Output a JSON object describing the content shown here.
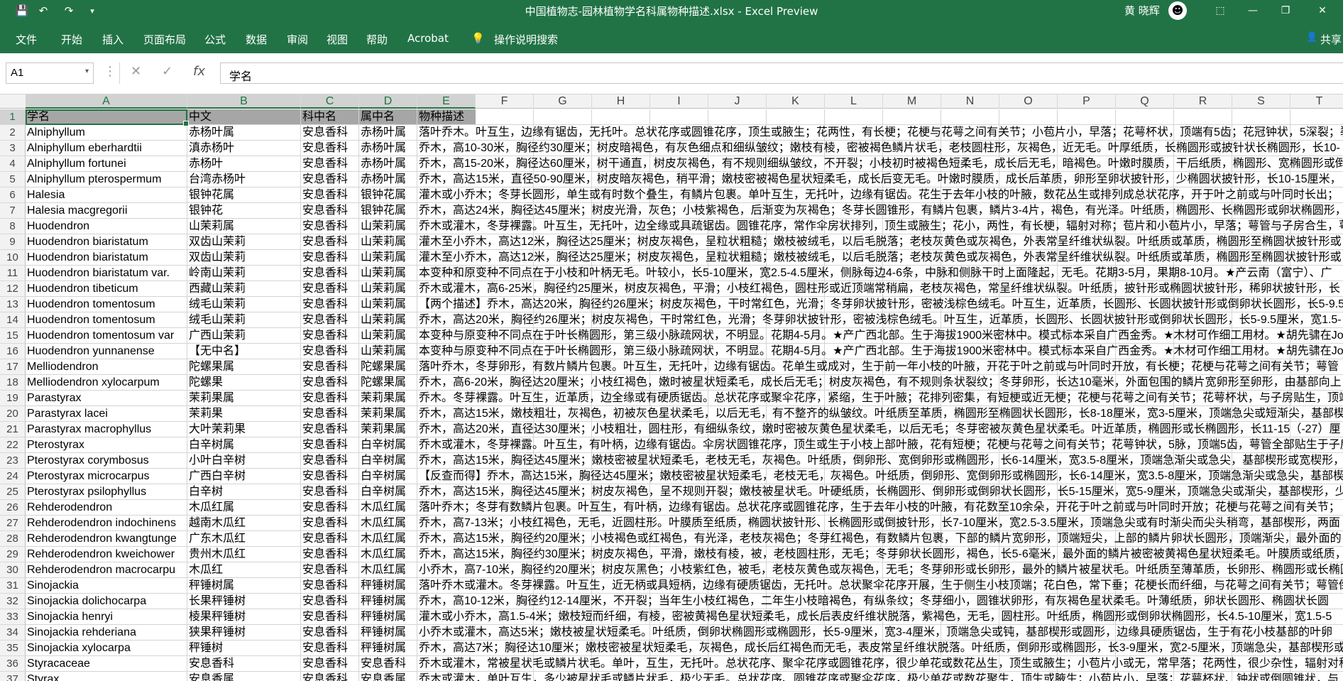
{
  "window": {
    "title": "中国植物志-园林植物学名科属物种描述.xlsx  -  Excel Preview",
    "user": "黄 晓辉",
    "qat": {
      "save": "💾",
      "undo": "↶",
      "redo": "↷",
      "customize": "▾"
    },
    "controls": {
      "ribbon_display": "⬚",
      "minimize": "—",
      "restore": "❐",
      "close": "✕"
    }
  },
  "ribbon": {
    "tabs": [
      "文件",
      "开始",
      "插入",
      "页面布局",
      "公式",
      "数据",
      "审阅",
      "视图",
      "帮助",
      "Acrobat"
    ],
    "tell_me": "操作说明搜索",
    "share": "共享",
    "tell_me_icon": "💡",
    "share_icon": "👤"
  },
  "formula_bar": {
    "name_box": "A1",
    "dropdown": "▾",
    "more": "⋮",
    "cancel": "✕",
    "enter": "✓",
    "fx": "fx",
    "content": "学名"
  },
  "columns": [
    "A",
    "B",
    "C",
    "D",
    "E",
    "F",
    "G",
    "H",
    "I",
    "J",
    "K",
    "L",
    "M",
    "N",
    "O",
    "P",
    "Q",
    "R",
    "S",
    "T"
  ],
  "rows": [
    {
      "n": "1",
      "cells": [
        "学名",
        "中文",
        "科中名",
        "属中名",
        "物种描述"
      ]
    },
    {
      "n": "2",
      "cells": [
        "Alniphyllum",
        "赤杨叶属",
        "安息香科",
        "赤杨叶属",
        "落叶乔木。叶互生，边缘有锯齿，无托叶。总状花序或圆锥花序，顶生或腋生；花两性，有长梗；花梗与花萼之间有关节；小苞片小，早落；花萼杯状，顶端有5齿；花冠钟状，5深裂；裂"
      ]
    },
    {
      "n": "3",
      "cells": [
        "Alniphyllum eberhardtii",
        "滇赤杨叶",
        "安息香科",
        "赤杨叶属",
        "乔木，高10-30米，胸径约30厘米；树皮暗褐色，有灰色细点和细纵皱纹；嫩枝有棱，密被褐色鳞片状毛，老枝圆柱形，灰褐色，近无毛。叶厚纸质，长椭圆形或披针状长椭圆形，长10-"
      ]
    },
    {
      "n": "4",
      "cells": [
        "Alniphyllum fortunei",
        "赤杨叶",
        "安息香科",
        "赤杨叶属",
        "乔木，高15-20米，胸径达60厘米，树干通直，树皮灰褐色，有不规则细纵皱纹，不开裂；小枝初时被褐色短柔毛，成长后无毛，暗褐色。叶嫩时膜质，干后纸质，椭圆形、宽椭圆形或倒"
      ]
    },
    {
      "n": "5",
      "cells": [
        "Alniphyllum pterospermum",
        "台湾赤杨叶",
        "安息香科",
        "赤杨叶属",
        "乔木，高达15米，直径50-90厘米，树皮暗灰褐色，稍平滑；嫩枝密被褐色星状短柔毛，成长后变无毛。叶嫩时膜质，成长后革质，卵形至卵状披针形，少椭圆状披针形，长10-15厘米，"
      ]
    },
    {
      "n": "6",
      "cells": [
        "Halesia",
        "银钟花属",
        "安息香科",
        "银钟花属",
        "灌木或小乔木；冬芽长圆形，单生或有时数个叠生，有鳞片包裹。单叶互生，无托叶，边缘有锯齿。花生于去年小枝的叶腋，数花丛生或排列成总状花序，开于叶之前或与叶同时长出；"
      ]
    },
    {
      "n": "7",
      "cells": [
        "Halesia macgregorii",
        "银钟花",
        "安息香科",
        "银钟花属",
        "乔木，高达24米，胸径达45厘米；树皮光滑，灰色；小枝紫褐色，后渐变为灰褐色；冬芽长圆锥形，有鳞片包裹，鳞片3-4片，褐色，有光泽。叶纸质，椭圆形、长椭圆形或卵状椭圆形，"
      ]
    },
    {
      "n": "8",
      "cells": [
        "Huodendron",
        "山茉莉属",
        "安息香科",
        "山茉莉属",
        "乔木或灌木，冬芽裸露。叶互生，无托叶，边全缘或具疏锯齿。圆锥花序，常作伞房状排列，顶生或腋生；花小，两性，有长梗，辐射对称；苞片和小苞片小，早落；萼管与子房合生，萼"
      ]
    },
    {
      "n": "9",
      "cells": [
        "Huodendron biaristatum",
        "双齿山茉莉",
        "安息香科",
        "山茉莉属",
        "灌木至小乔木，高达12米，胸径达25厘米；树皮灰褐色，呈粒状粗糙；嫩枝被绒毛，以后毛脱落；老枝灰黄色或灰褐色，外表常呈纤维状纵裂。叶纸质或革质，椭圆形至椭圆状披针形或"
      ]
    },
    {
      "n": "10",
      "cells": [
        "Huodendron biaristatum",
        "双齿山茉莉",
        "安息香科",
        "山茉莉属",
        "灌木至小乔木，高达12米，胸径达25厘米；树皮灰褐色，呈粒状粗糙；嫩枝被绒毛，以后毛脱落；老枝灰黄色或灰褐色，外表常呈纤维状纵裂。叶纸质或革质，椭圆形至椭圆状披针形或"
      ]
    },
    {
      "n": "11",
      "cells": [
        "Huodendron biaristatum var.",
        "岭南山茉莉",
        "安息香科",
        "山茉莉属",
        "本变种和原变种不同点在于小枝和叶柄无毛。叶较小，长5-10厘米，宽2.5-4.5厘米，侧脉每边4-6条，中脉和侧脉干时上面隆起，无毛。花期3-5月，果期8-10月。★产云南（富宁）、广"
      ]
    },
    {
      "n": "12",
      "cells": [
        "Huodendron tibeticum",
        "西藏山茉莉",
        "安息香科",
        "山茉莉属",
        "乔木或灌木，高6-25米，胸径约25厘米，树皮灰褐色，平滑；小枝红褐色，圆柱形或近顶端常稍扁，老枝灰褐色，常呈纤维状纵裂。叶纸质，披针形或椭圆状披针形，稀卵状披针形，长"
      ]
    },
    {
      "n": "13",
      "cells": [
        "Huodendron tomentosum",
        "绒毛山茉莉",
        "安息香科",
        "山茉莉属",
        "【两个描述】乔木，高达20米，胸径约26厘米；树皮灰褐色，干时常红色，光滑；冬芽卵状披针形，密被浅棕色绒毛。叶互生，近革质，长圆形、长圆状披针形或倒卵状长圆形，长5-9.5"
      ]
    },
    {
      "n": "14",
      "cells": [
        "Huodendron tomentosum",
        "绒毛山茉莉",
        "安息香科",
        "山茉莉属",
        "乔木，高达20米，胸径约26厘米；树皮灰褐色，干时常红色，光滑；冬芽卵状披针形，密被浅棕色绒毛。叶互生，近革质，长圆形、长圆状披针形或倒卵状长圆形，长5-9.5厘米，宽1.5-"
      ]
    },
    {
      "n": "15",
      "cells": [
        "Huodendron tomentosum var",
        "广西山茉莉",
        "安息香科",
        "山茉莉属",
        "本变种与原变种不同点在于叶长椭圆形，第三级小脉疏网状，不明显。花期4-5月。★产广西北部。生于海拔1900米密林中。模式标本采自广西金秀。★木材可作细工用材。★胡先骕在Jou"
      ]
    },
    {
      "n": "16",
      "cells": [
        "Huodendron yunnanense",
        "【无中名】",
        "安息香科",
        "山茉莉属",
        "本变种与原变种不同点在于叶长椭圆形，第三级小脉疏网状，不明显。花期4-5月。★产广西北部。生于海拔1900米密林中。模式标本采自广西金秀。★木材可作细工用材。★胡先骕在Jou"
      ]
    },
    {
      "n": "17",
      "cells": [
        "Melliodendron",
        "陀螺果属",
        "安息香科",
        "陀螺果属",
        "落叶乔木，冬芽卵形，有数片鳞片包裹。叶互生，无托叶，边缘有锯齿。花单生或成对，生于前一年小枝的叶腋，开花于叶之前或与叶同时开放，有长梗；花梗与花萼之间有关节；萼管"
      ]
    },
    {
      "n": "18",
      "cells": [
        "Melliodendron xylocarpum",
        "陀螺果",
        "安息香科",
        "陀螺果属",
        "乔木，高6-20米，胸径达20厘米；小枝红褐色，嫩时被星状短柔毛，成长后无毛；树皮灰褐色，有不规则条状裂纹；冬芽卵形，长达10毫米，外面包围的鳞片宽卵形至卵形，由基部向上"
      ]
    },
    {
      "n": "19",
      "cells": [
        "Parastyrax",
        "茉莉果属",
        "安息香科",
        "茉莉果属",
        "乔木。冬芽裸露。叶互生，近革质，边全缘或有硬质锯齿。总状花序或聚伞花序，紧缩，生于叶腋；花排列密集，有短梗或近无梗；花梗与花萼之间有关节；花萼杯状，与子房贴生，顶端"
      ]
    },
    {
      "n": "20",
      "cells": [
        "Parastyrax lacei",
        "茉莉果",
        "安息香科",
        "茉莉果属",
        "乔木，高达15米，嫩枝粗壮，灰褐色，初被灰色星状柔毛，以后无毛，有不整齐的纵皱纹。叶纸质至革质，椭圆形至椭圆状长圆形，长8-18厘米，宽3-5厘米，顶端急尖或短渐尖，基部楔"
      ]
    },
    {
      "n": "21",
      "cells": [
        "Parastyrax macrophyllus",
        "大叶茉莉果",
        "安息香科",
        "茉莉果属",
        "乔木，高达20米，直径达30厘米；小枝粗壮，圆柱形，有细纵条纹，嫩时密被灰黄色星状柔毛，以后无毛；冬芽密被灰黄色星状柔毛。叶近革质，椭圆形或长椭圆形，长11-15（-27）厘"
      ]
    },
    {
      "n": "22",
      "cells": [
        "Pterostyrax",
        "白辛树属",
        "安息香科",
        "白辛树属",
        "乔木或灌木，冬芽裸露。叶互生，有叶柄，边缘有锯齿。伞房状圆锥花序，顶生或生于小枝上部叶腋，花有短梗；花梗与花萼之间有关节；花萼钟状，5脉，顶端5齿，萼管全部贴生于子房"
      ]
    },
    {
      "n": "23",
      "cells": [
        "Pterostyrax corymbosus",
        "小叶白辛树",
        "安息香科",
        "白辛树属",
        "乔木，高达15米，胸径达45厘米；嫩枝密被星状短柔毛，老枝无毛，灰褐色。叶纸质，倒卵形、宽倒卵形或椭圆形，长6-14厘米，宽3.5-8厘米，顶端急渐尖或急尖，基部楔形或宽楔形，"
      ]
    },
    {
      "n": "24",
      "cells": [
        "Pterostyrax microcarpus",
        "广西白辛树",
        "安息香科",
        "白辛树属",
        "【反查而得】乔木，高达15米，胸径达45厘米；嫩枝密被星状短柔毛，老枝无毛，灰褐色。叶纸质，倒卵形、宽倒卵形或椭圆形，长6-14厘米，宽3.5-8厘米，顶端急渐尖或急尖，基部楔"
      ]
    },
    {
      "n": "25",
      "cells": [
        "Pterostyrax psilophyllus",
        "白辛树",
        "安息香科",
        "白辛树属",
        "乔木，高达15米，胸径达45厘米；树皮灰褐色，呈不规则开裂；嫩枝被星状毛。叶硬纸质，长椭圆形、倒卵形或倒卵状长圆形，长5-15厘米，宽5-9厘米，顶端急尖或渐尖，基部楔形，少"
      ]
    },
    {
      "n": "26",
      "cells": [
        "Rehderodendron",
        "木瓜红属",
        "安息香科",
        "木瓜红属",
        "落叶乔木；冬芽有数鳞片包裹。叶互生，有叶柄，边缘有锯齿。总状花序或圆锥花序，生于去年小枝的叶腋，有花数至10余朵，开花于叶之前或与叶同时开放；花梗与花萼之间有关节；"
      ]
    },
    {
      "n": "27",
      "cells": [
        "Rehderodendron indochinens",
        "越南木瓜红",
        "安息香科",
        "木瓜红属",
        "乔木，高7-13米；小枝红褐色，无毛，近圆柱形。叶膜质至纸质，椭圆状披针形、长椭圆形或倒披针形，长7-10厘米，宽2.5-3.5厘米，顶端急尖或有时渐尖而尖头稍弯，基部楔形，两面"
      ]
    },
    {
      "n": "28",
      "cells": [
        "Rehderodendron kwangtunge",
        "广东木瓜红",
        "安息香科",
        "木瓜红属",
        "乔木，高达15米，胸径约20厘米；小枝褐色或红褐色，有光泽，老枝灰褐色；冬芽红褐色，有数鳞片包裹，下部的鳞片宽卵形，顶端短尖，上部的鳞片卵状长圆形，顶端渐尖，最外面的"
      ]
    },
    {
      "n": "29",
      "cells": [
        "Rehderodendron kweichower",
        "贵州木瓜红",
        "安息香科",
        "木瓜红属",
        "乔木，高达15米，胸径约30厘米；树皮灰褐色，平滑，嫩枝有棱，被，老枝圆柱形，无毛；冬芽卵状长圆形，褐色，长5-6毫米，最外面的鳞片被密被黄褐色星状短柔毛。叶膜质或纸质，"
      ]
    },
    {
      "n": "30",
      "cells": [
        "Rehderodendron macrocarpu",
        "木瓜红",
        "安息香科",
        "木瓜红属",
        "小乔木，高7-10米，胸径约20厘米；树皮灰黑色；小枝紫红色，被毛，老枝灰黄色或灰褐色，无毛；冬芽卵形或长卵形，最外的鳞片被星状毛。叶纸质至薄革质，长卵形、椭圆形或长椭圆"
      ]
    },
    {
      "n": "31",
      "cells": [
        "Sinojackia",
        "秤锤树属",
        "安息香科",
        "秤锤树属",
        "落叶乔木或灌木。冬芽裸露。叶互生，近无柄或具短柄，边缘有硬质锯齿，无托叶。总状聚伞花序开展，生于侧生小枝顶端；花白色，常下垂；花梗长而纤细，与花萼之间有关节；萼管倒"
      ]
    },
    {
      "n": "32",
      "cells": [
        "Sinojackia dolichocarpa",
        "长果秤锤树",
        "安息香科",
        "秤锤树属",
        "乔木，高10-12米，胸径约12-14厘米，不开裂；当年生小枝红褐色，二年生小枝暗褐色，有纵条纹；冬芽细小，圆锥状卵形，有灰褐色星状柔毛。叶薄纸质，卵状长圆形、椭圆状长圆"
      ]
    },
    {
      "n": "33",
      "cells": [
        "Sinojackia henryi",
        "棱果秤锤树",
        "安息香科",
        "秤锤树属",
        "灌木或小乔木，高1.5-4米；嫩枝短而纤细，有棱，密被黄褐色星状短柔毛，成长后表皮纤维状脱落，紫褐色，无毛，圆柱形。叶纸质，椭圆形或倒卵状椭圆形，长4.5-10厘米，宽1.5-5"
      ]
    },
    {
      "n": "34",
      "cells": [
        "Sinojackia rehderiana",
        "狭果秤锤树",
        "安息香科",
        "秤锤树属",
        "小乔木或灌木，高达5米；嫩枝被星状短柔毛。叶纸质，倒卵状椭圆形或椭圆形，长5-9厘米，宽3-4厘米，顶端急尖或钝，基部楔形或圆形，边缘具硬质锯齿，生于有花小枝基部的叶卵"
      ]
    },
    {
      "n": "35",
      "cells": [
        "Sinojackia xylocarpa",
        "秤锤树",
        "安息香科",
        "秤锤树属",
        "乔木，高达7米；胸径达10厘米；嫩枝密被星状短柔毛，灰褐色，成长后红褐色而无毛，表皮常呈纤维状脱落。叶纸质，倒卵形或椭圆形，长3-9厘米，宽2-5厘米，顶端急尖，基部楔形或"
      ]
    },
    {
      "n": "36",
      "cells": [
        "Styracaceae",
        "安息香科",
        "安息香科",
        "安息香科",
        "乔木或灌木，常被星状毛或鳞片状毛。单叶，互生，无托叶。总状花序、聚伞花序或圆锥花序，很少单花或数花丛生，顶生或腋生；小苞片小或无，常早落；花两性，很少杂性，辐射对称；"
      ]
    },
    {
      "n": "37",
      "cells": [
        "Styrax",
        "安息香属",
        "安息香科",
        "安息香属",
        "乔木或灌木，单叶互生，多少被星状毛或鳞片状毛，极少无毛。总状花序、圆锥花序或聚伞花序，极少单花或数花聚生，顶生或腋生；小苞片小，早落；花萼杯状、钟状或倒圆锥状，与"
      ]
    }
  ]
}
